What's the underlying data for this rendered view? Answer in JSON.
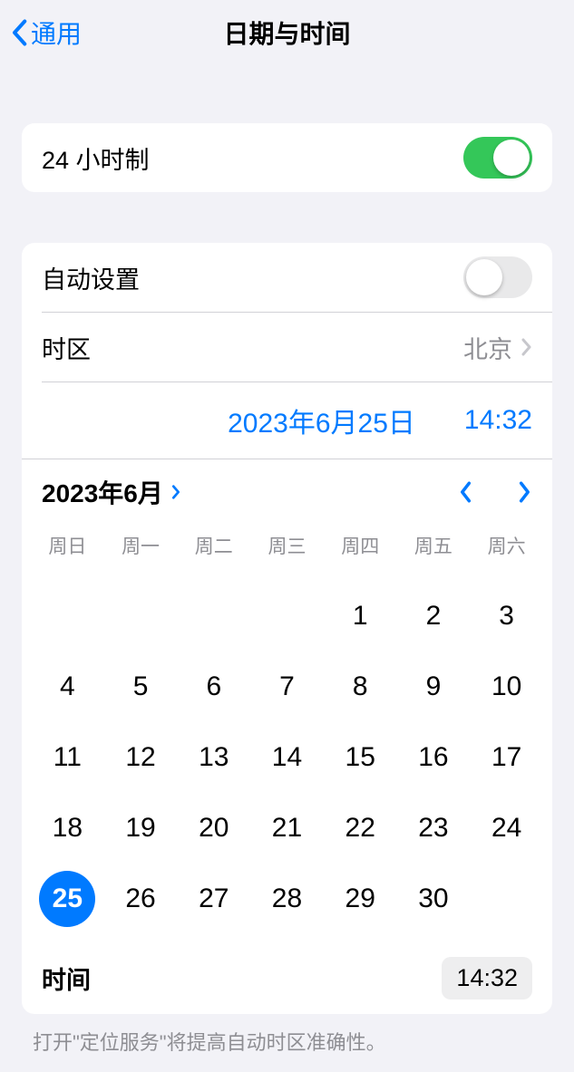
{
  "header": {
    "back": "通用",
    "title": "日期与时间"
  },
  "group1": {
    "twentyFourHourLabel": "24 小时制",
    "twentyFourHourOn": true
  },
  "group2": {
    "autoSetLabel": "自动设置",
    "autoSetOn": false,
    "timezoneLabel": "时区",
    "timezoneValue": "北京",
    "currentDate": "2023年6月25日",
    "currentTime": "14:32",
    "monthTitle": "2023年6月",
    "weekdays": [
      "周日",
      "周一",
      "周二",
      "周三",
      "周四",
      "周五",
      "周六"
    ],
    "days": [
      "",
      "",
      "",
      "",
      "1",
      "2",
      "3",
      "4",
      "5",
      "6",
      "7",
      "8",
      "9",
      "10",
      "11",
      "12",
      "13",
      "14",
      "15",
      "16",
      "17",
      "18",
      "19",
      "20",
      "21",
      "22",
      "23",
      "24",
      "25",
      "26",
      "27",
      "28",
      "29",
      "30"
    ],
    "selectedDay": "25",
    "timeLabel": "时间",
    "timeValue": "14:32"
  },
  "footerNote": "打开\"定位服务\"将提高自动时区准确性。"
}
